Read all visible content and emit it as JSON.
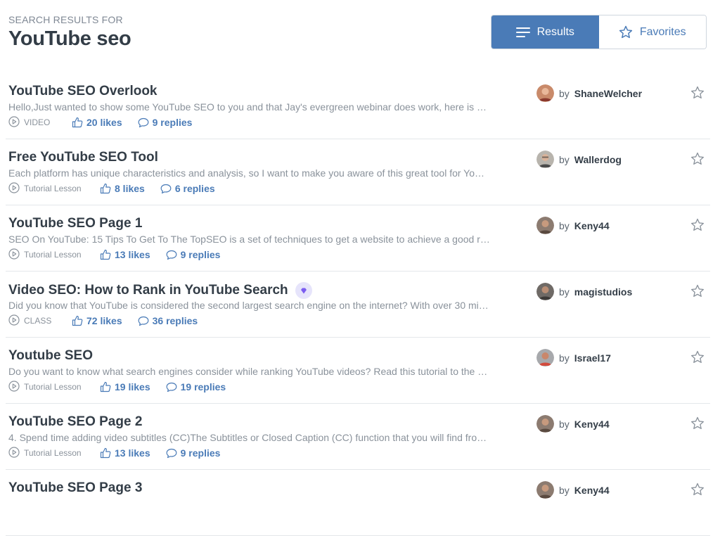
{
  "header": {
    "eyebrow": "SEARCH RESULTS FOR",
    "query": "YouTube seo"
  },
  "view_toggle": {
    "results_label": "Results",
    "favorites_label": "Favorites",
    "active": "results"
  },
  "colors": {
    "accent": "#4a7bb7",
    "badge": "#7b5cf0"
  },
  "results": [
    {
      "title": "YouTube SEO Overlook",
      "description": "Hello,Just wanted to show some YouTube SEO to you and that Jay's evergreen webinar does work, here is …",
      "type": "VIDEO",
      "likes": "20 likes",
      "replies": "9 replies",
      "by": "by",
      "author": "ShaneWelcher",
      "badge": false
    },
    {
      "title": "Free YouTube SEO Tool",
      "description": "Each platform has unique characteristics and analysis, so I want to make you aware of this great tool for Yo…",
      "type": "Tutorial Lesson",
      "likes": "8 likes",
      "replies": "6 replies",
      "by": "by",
      "author": "Wallerdog",
      "badge": false
    },
    {
      "title": "YouTube SEO Page 1",
      "description": "SEO On YouTube: 15 Tips To Get To The TopSEO is a set of techniques to get a website to achieve a good r…",
      "type": "Tutorial Lesson",
      "likes": "13 likes",
      "replies": "9 replies",
      "by": "by",
      "author": "Keny44",
      "badge": false
    },
    {
      "title": "Video SEO: How to Rank in YouTube Search",
      "description": "Did you know that YouTube is considered the second largest search engine on the internet? With over 30 mi…",
      "type": "CLASS",
      "likes": "72 likes",
      "replies": "36 replies",
      "by": "by",
      "author": "magistudios",
      "badge": true
    },
    {
      "title": "Youtube SEO",
      "description": "Do you want to know what search engines consider while ranking YouTube videos? Read this tutorial to the …",
      "type": "Tutorial Lesson",
      "likes": "19 likes",
      "replies": "19 replies",
      "by": "by",
      "author": "Israel17",
      "badge": false
    },
    {
      "title": "YouTube SEO Page 2",
      "description": "4. Spend time adding video subtitles (CC)The Subtitles or Closed Caption (CC) function that you will find fro…",
      "type": "Tutorial Lesson",
      "likes": "13 likes",
      "replies": "9 replies",
      "by": "by",
      "author": "Keny44",
      "badge": false
    },
    {
      "title": "YouTube SEO Page 3",
      "description": "",
      "type": "",
      "likes": "",
      "replies": "",
      "by": "by",
      "author": "Keny44",
      "badge": false
    }
  ]
}
